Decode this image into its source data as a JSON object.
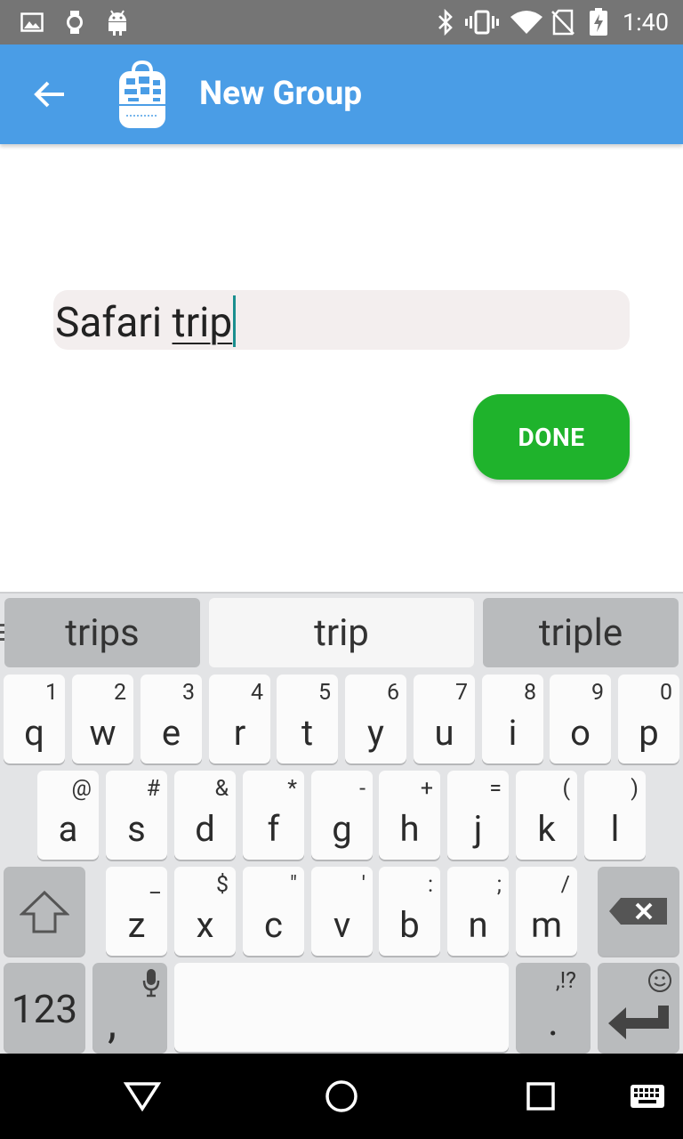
{
  "status_bar": {
    "time": "1:40",
    "icons": [
      "gallery-icon",
      "watch-icon",
      "android-icon",
      "bluetooth-icon",
      "vibrate-icon",
      "wifi-icon",
      "no-sim-icon",
      "battery-charging-icon"
    ]
  },
  "app_bar": {
    "title": "New Group",
    "back_icon": "back-arrow-icon",
    "logo_icon": "backpack-logo-icon",
    "color": "#4a9de6"
  },
  "form": {
    "group_name_value_plain": "Safari ",
    "group_name_value_composing": "trip",
    "done_label": "DONE",
    "done_color": "#1fb32c"
  },
  "keyboard": {
    "suggestions": [
      "trips",
      "trip",
      "triple"
    ],
    "row1": [
      {
        "key": "q",
        "hint": "1"
      },
      {
        "key": "w",
        "hint": "2"
      },
      {
        "key": "e",
        "hint": "3"
      },
      {
        "key": "r",
        "hint": "4"
      },
      {
        "key": "t",
        "hint": "5"
      },
      {
        "key": "y",
        "hint": "6"
      },
      {
        "key": "u",
        "hint": "7"
      },
      {
        "key": "i",
        "hint": "8"
      },
      {
        "key": "o",
        "hint": "9"
      },
      {
        "key": "p",
        "hint": "0"
      }
    ],
    "row2": [
      {
        "key": "a",
        "hint": "@"
      },
      {
        "key": "s",
        "hint": "#"
      },
      {
        "key": "d",
        "hint": "&"
      },
      {
        "key": "f",
        "hint": "*"
      },
      {
        "key": "g",
        "hint": "-"
      },
      {
        "key": "h",
        "hint": "+"
      },
      {
        "key": "j",
        "hint": "="
      },
      {
        "key": "k",
        "hint": "("
      },
      {
        "key": "l",
        "hint": ")"
      }
    ],
    "row3": [
      {
        "key": "z",
        "hint": "_"
      },
      {
        "key": "x",
        "hint": "$"
      },
      {
        "key": "c",
        "hint": "\""
      },
      {
        "key": "v",
        "hint": "'"
      },
      {
        "key": "b",
        "hint": ":"
      },
      {
        "key": "n",
        "hint": ";"
      },
      {
        "key": "m",
        "hint": "/"
      }
    ],
    "symbols_label": "123",
    "comma_label": ",",
    "period_label": ".",
    "period_hint": ",!?",
    "shift_icon": "shift-icon",
    "backspace_icon": "backspace-icon",
    "enter_icon": "enter-icon",
    "emoji_icon": "emoji-icon",
    "mic_icon": "mic-icon"
  },
  "nav_bar": {
    "icons": [
      "back-triangle-icon",
      "home-circle-icon",
      "recents-square-icon",
      "keyboard-icon"
    ]
  }
}
